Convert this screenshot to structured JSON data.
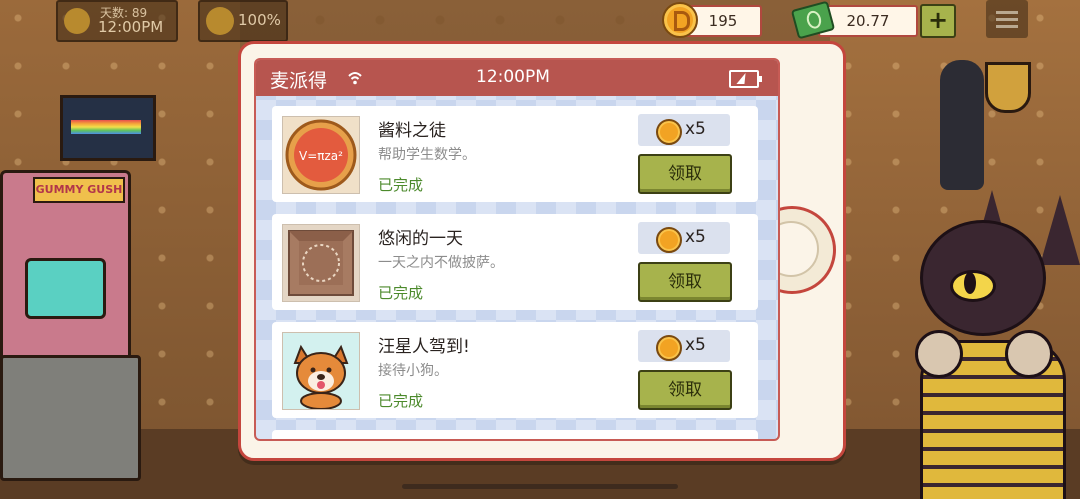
{
  "hud": {
    "day_label": "天数: 89",
    "clock": "12:00PM",
    "satisfaction": "100%",
    "coins": "195",
    "cash": "20.77",
    "add_cash_label": "+"
  },
  "scene": {
    "arcade_marquee": "GUMMY GUSH"
  },
  "tablet": {
    "app_name": "麦派得",
    "time": "12:00PM"
  },
  "achievements": [
    {
      "title": "酱料之徒",
      "description": "帮助学生数学。",
      "status": "已完成",
      "reward": "x5",
      "claim_label": "领取",
      "thumb_text": "V=πza²",
      "thumb": "pizza-formula-icon"
    },
    {
      "title": "悠闲的一天",
      "description": "一天之内不做披萨。",
      "status": "已完成",
      "reward": "x5",
      "claim_label": "领取",
      "thumb": "empty-pizza-box-icon"
    },
    {
      "title": "汪星人驾到!",
      "description": "接待小狗。",
      "status": "已完成",
      "reward": "x5",
      "claim_label": "领取",
      "thumb": "shiba-dog-icon"
    }
  ],
  "colors": {
    "status_bar": "#b7554f",
    "claim_button": "#a7b34c",
    "completed_text": "#4c8a2c",
    "coin": "#f2a323"
  }
}
